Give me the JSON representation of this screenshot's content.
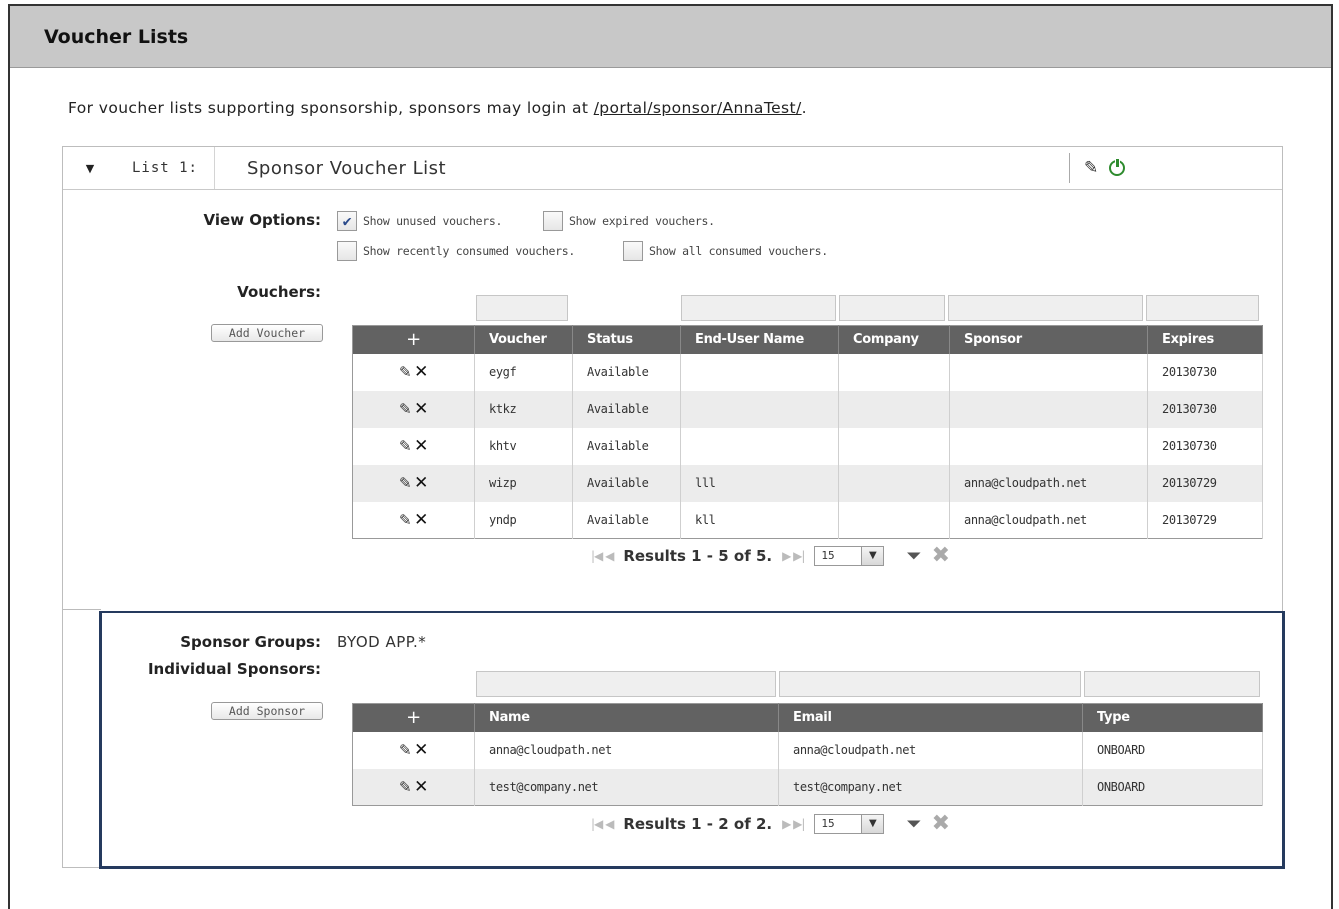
{
  "page": {
    "title": "Voucher Lists",
    "intro_text": "For voucher lists supporting sponsorship, sponsors may login at",
    "intro_link": "/portal/sponsor/AnnaTest/",
    "intro_suffix": "."
  },
  "list": {
    "label": "List 1:",
    "name": "Sponsor Voucher List",
    "toggle_icon": "triangle-down",
    "edit_icon": "pencil",
    "power_icon": "power"
  },
  "view_options": {
    "label": "View Options:",
    "options": [
      {
        "label": "Show unused vouchers.",
        "checked": true
      },
      {
        "label": "Show expired vouchers.",
        "checked": false
      },
      {
        "label": "Show recently consumed vouchers.",
        "checked": false
      },
      {
        "label": "Show all consumed vouchers.",
        "checked": false
      }
    ]
  },
  "vouchers": {
    "label": "Vouchers:",
    "add_button": "Add Voucher",
    "columns": [
      "+",
      "Voucher",
      "Status",
      "End-User Name",
      "Company",
      "Sponsor",
      "Expires"
    ],
    "rows": [
      {
        "voucher": "eygf",
        "status": "Available",
        "end_user": "",
        "company": "",
        "sponsor": "",
        "expires": "20130730"
      },
      {
        "voucher": "ktkz",
        "status": "Available",
        "end_user": "",
        "company": "",
        "sponsor": "",
        "expires": "20130730"
      },
      {
        "voucher": "khtv",
        "status": "Available",
        "end_user": "",
        "company": "",
        "sponsor": "",
        "expires": "20130730"
      },
      {
        "voucher": "wizp",
        "status": "Available",
        "end_user": "lll",
        "company": "",
        "sponsor": "anna@cloudpath.net",
        "expires": "20130729"
      },
      {
        "voucher": "yndp",
        "status": "Available",
        "end_user": "kll",
        "company": "",
        "sponsor": "anna@cloudpath.net",
        "expires": "20130729"
      }
    ],
    "results": "Results 1 - 5 of 5.",
    "page_size": "15"
  },
  "sponsors": {
    "groups_label": "Sponsor Groups:",
    "groups_value": "BYOD APP.*",
    "individual_label": "Individual Sponsors:",
    "add_button": "Add Sponsor",
    "columns": [
      "+",
      "Name",
      "Email",
      "Type"
    ],
    "rows": [
      {
        "name": "anna@cloudpath.net",
        "email": "anna@cloudpath.net",
        "type": "ONBOARD"
      },
      {
        "name": "test@company.net",
        "email": "test@company.net",
        "type": "ONBOARD"
      }
    ],
    "results": "Results 1 - 2 of 2.",
    "page_size": "15"
  }
}
